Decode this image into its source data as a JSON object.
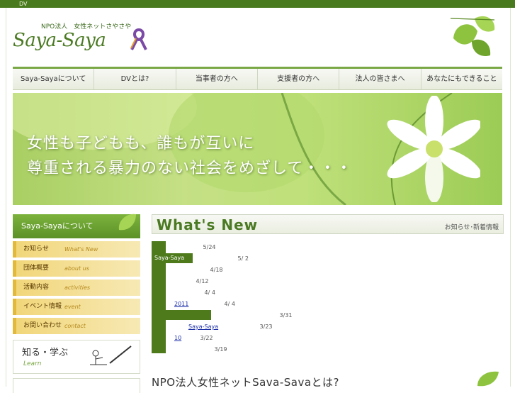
{
  "topbar": {
    "label": "DV"
  },
  "logo": {
    "org": "NPO法人　女性ネットさやさや",
    "name": "Saya-Saya"
  },
  "nav": [
    "Saya-Sayaについて",
    "DVとは?",
    "当事者の方へ",
    "支援者の方へ",
    "法人の皆さまへ",
    "あなたにもできること"
  ],
  "hero": {
    "line1": "女性も子どもも、誰もが互いに",
    "line2": "尊重される暴力のない社会をめざして・・・"
  },
  "sidebar": {
    "header": "Saya-Sayaについて",
    "items": [
      {
        "jp": "お知らせ",
        "en": "What's New"
      },
      {
        "jp": "団体概要",
        "en": "about us"
      },
      {
        "jp": "活動内容",
        "en": "activities"
      },
      {
        "jp": "イベント情報",
        "en": "event"
      },
      {
        "jp": "お問い合わせ",
        "en": "contact"
      }
    ],
    "learn": {
      "title": "知る・学ぶ",
      "sub": "Learn"
    }
  },
  "whats_new": {
    "title": "What's New",
    "subtitle": "お知らせ･新着情報",
    "label": "Saya-Saya",
    "items": [
      {
        "link": "",
        "date": "5/24"
      },
      {
        "link": "",
        "date": "5/ 2"
      },
      {
        "link": "",
        "date": "4/18"
      },
      {
        "link": "",
        "date": "4/12"
      },
      {
        "link": "",
        "date": "4/ 4"
      },
      {
        "link": "2011",
        "date": "4/ 4"
      },
      {
        "link": "",
        "date": "3/31"
      },
      {
        "link": "Saya-Saya",
        "date": "3/23"
      },
      {
        "link": "10",
        "date": "3/22"
      },
      {
        "link": "",
        "date": "3/19"
      }
    ]
  },
  "about_heading": "NPO法人女性ネットSava-Savaとは?"
}
